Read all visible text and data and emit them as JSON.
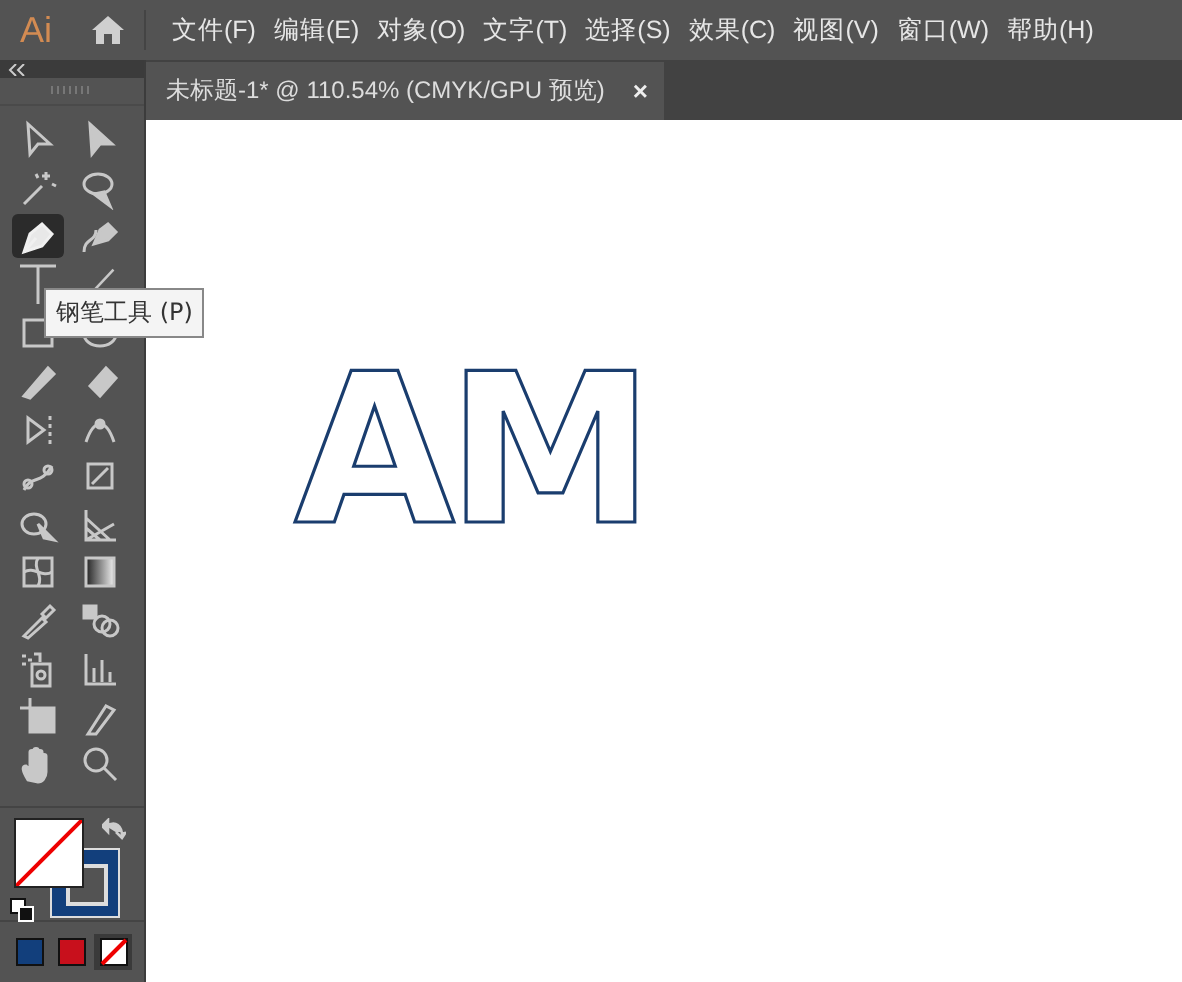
{
  "app": {
    "logo": "Ai"
  },
  "menu": [
    "文件(F)",
    "编辑(E)",
    "对象(O)",
    "文字(T)",
    "选择(S)",
    "效果(C)",
    "视图(V)",
    "窗口(W)",
    "帮助(H)"
  ],
  "document_tab": {
    "title": "未标题-1* @ 110.54% (CMYK/GPU 预览)",
    "close": "×",
    "selected": true
  },
  "tools": [
    {
      "kind": "select",
      "selected": false
    },
    {
      "kind": "direct",
      "selected": false
    },
    {
      "kind": "wand",
      "selected": false
    },
    {
      "kind": "lasso",
      "selected": false
    },
    {
      "kind": "pen",
      "selected": true
    },
    {
      "kind": "curvature",
      "selected": false
    },
    {
      "kind": "type",
      "selected": false
    },
    {
      "kind": "line",
      "selected": false
    },
    {
      "kind": "rect",
      "selected": false
    },
    {
      "kind": "ellipse",
      "selected": false
    },
    {
      "kind": "brush",
      "selected": false
    },
    {
      "kind": "eraser",
      "selected": false
    },
    {
      "kind": "rotate",
      "selected": false
    },
    {
      "kind": "width",
      "selected": false
    },
    {
      "kind": "puppet",
      "selected": false
    },
    {
      "kind": "transform",
      "selected": false
    },
    {
      "kind": "builder",
      "selected": false
    },
    {
      "kind": "perspective",
      "selected": false
    },
    {
      "kind": "mesh",
      "selected": false
    },
    {
      "kind": "gradient",
      "selected": false
    },
    {
      "kind": "eyedropper",
      "selected": false
    },
    {
      "kind": "blend",
      "selected": false
    },
    {
      "kind": "sprayer",
      "selected": false
    },
    {
      "kind": "graph",
      "selected": false
    },
    {
      "kind": "artboard",
      "selected": false
    },
    {
      "kind": "knife",
      "selected": false
    },
    {
      "kind": "hand",
      "selected": false
    },
    {
      "kind": "zoom",
      "selected": false
    }
  ],
  "tooltip": "钢笔工具 (P)",
  "fill": {
    "kind": "none"
  },
  "stroke": {
    "color": "#123f7c"
  },
  "color_modes": [
    {
      "kind": "color",
      "color": "#123f7c",
      "selected": false
    },
    {
      "kind": "gradient",
      "color": "#c8101c",
      "selected": false
    },
    {
      "kind": "none",
      "selected": true
    }
  ],
  "canvas": {
    "text": "AM"
  }
}
